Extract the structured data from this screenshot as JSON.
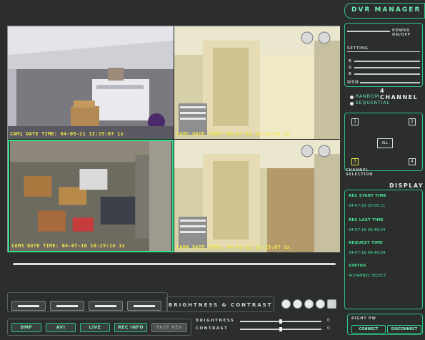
{
  "app": {
    "title": "DVR MANAGER"
  },
  "cameras": [
    {
      "label": "CAM1 DATE TIME: 04-05-21 12:25:07  1x"
    },
    {
      "label": "CAM2 DATE TIME: 04-07-16 10:25:14  1x"
    },
    {
      "label": "CAM3 DATE TIME: 04-07-16 10:25:14  1x"
    },
    {
      "label": "CAM4 DATE TIME: 04-05-21 12:25:07  1x"
    }
  ],
  "right_panel": {
    "power_label": "POWER ON/OFF",
    "setting_label": "SETTING",
    "osd_label": "OSD",
    "setting_rows": [
      "R",
      "G",
      "B"
    ],
    "channel_section": "4 CHANNEL",
    "radio_random": "RANDOM",
    "radio_sequential": "SEQUENTIAL",
    "channel_numbers": [
      "1",
      "2",
      "3",
      "4"
    ],
    "center_label": "ALL",
    "channel_selection": "CHANNEL\nSELECTION",
    "display_title": "DISPLAY",
    "rec_start_label": "REC START TIME",
    "rec_start_value": "04-07-16  20:05:11",
    "rec_last_label": "REC LAST TIME",
    "rec_last_value": "04-07-16  08:40:34",
    "request_label": "REQUEST TIME",
    "request_value": "04-07-16  08:40:34",
    "status_label": "STATUS",
    "status_value": "4CHANNEL SELECT",
    "remote_label": "RIGHT PW",
    "connect_label": "CONNECT",
    "disconnect_label": "DISCONNECT"
  },
  "bottom": {
    "brightness_contrast": "BRIGHTNESS & CONTRAST",
    "brightness_label": "BRIGHTNESS",
    "contrast_label": "CONTRAST",
    "brightness_value": "0",
    "contrast_value": "0",
    "mode_buttons": [
      "BMP",
      "AVI",
      "LIVE",
      "REC INFO",
      "FAST REV"
    ]
  },
  "colors": {
    "accent": "#2ec485",
    "osd": "#f2e64a",
    "panel": "#2b2e2d"
  }
}
